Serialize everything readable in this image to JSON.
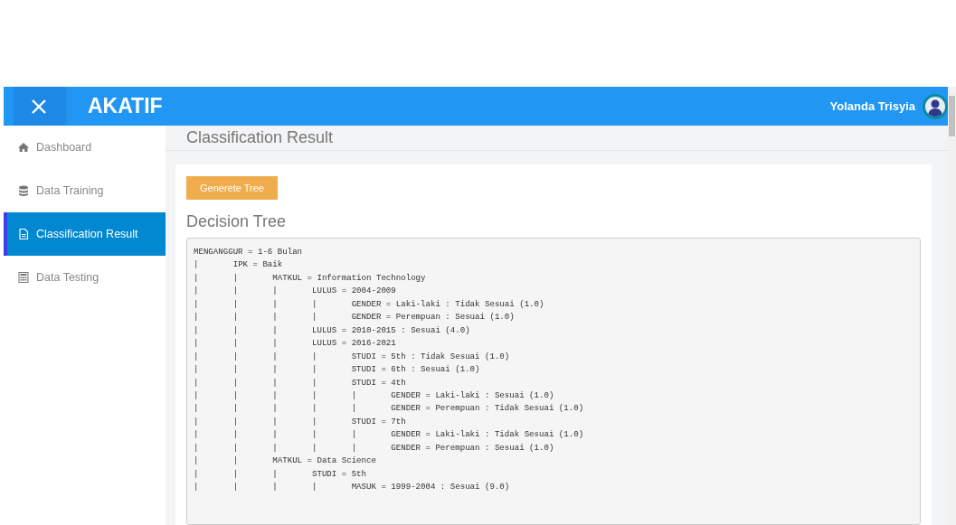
{
  "navbar": {
    "brand": "AKATIF",
    "user_name": "Yolanda Trisyia"
  },
  "sidebar": {
    "items": [
      {
        "label": "Dashboard",
        "selected": false
      },
      {
        "label": "Data Training",
        "selected": false
      },
      {
        "label": "Classification Result",
        "selected": true
      },
      {
        "label": "Data Testing",
        "selected": false
      }
    ]
  },
  "page_title": "Classification Result",
  "card": {
    "button": "Generete Tree",
    "heading": "Decision Tree",
    "tree": {
      "guide": "|",
      "nodes": [
        {
          "text": "MENGANGGUR = 1-6 Bulan",
          "children": [
            {
              "text": "IPK = Baik",
              "children": [
                {
                  "text": "MATKUL = Information Technology",
                  "children": [
                    {
                      "text": "LULUS = 2004-2009",
                      "children": [
                        {
                          "text": "GENDER = Laki-laki : Tidak Sesuai (1.0)"
                        },
                        {
                          "text": "GENDER = Perempuan : Sesuai (1.0)"
                        }
                      ]
                    },
                    {
                      "text": "LULUS = 2010-2015 : Sesuai (4.0)"
                    },
                    {
                      "text": "LULUS = 2016-2021",
                      "children": [
                        {
                          "text": "STUDI = 5th : Tidak Sesuai (1.0)"
                        },
                        {
                          "text": "STUDI = 6th : Sesuai (1.0)"
                        },
                        {
                          "text": "STUDI = 4th",
                          "children": [
                            {
                              "text": "GENDER = Laki-laki : Sesuai (1.0)"
                            },
                            {
                              "text": "GENDER = Perempuan : Tidak Sesuai (1.0)"
                            }
                          ]
                        },
                        {
                          "text": "STUDI = 7th",
                          "children": [
                            {
                              "text": "GENDER = Laki-laki : Tidak Sesuai (1.0)"
                            },
                            {
                              "text": "GENDER = Perempuan : Sesuai (1.0)"
                            }
                          ]
                        }
                      ]
                    }
                  ]
                },
                {
                  "text": "MATKUL = Data Science",
                  "children": [
                    {
                      "text": "STUDI = 5th",
                      "children": [
                        {
                          "text": "MASUK = 1999-2004 : Sesuai (9.0)"
                        }
                      ]
                    }
                  ]
                }
              ]
            }
          ]
        }
      ]
    }
  }
}
